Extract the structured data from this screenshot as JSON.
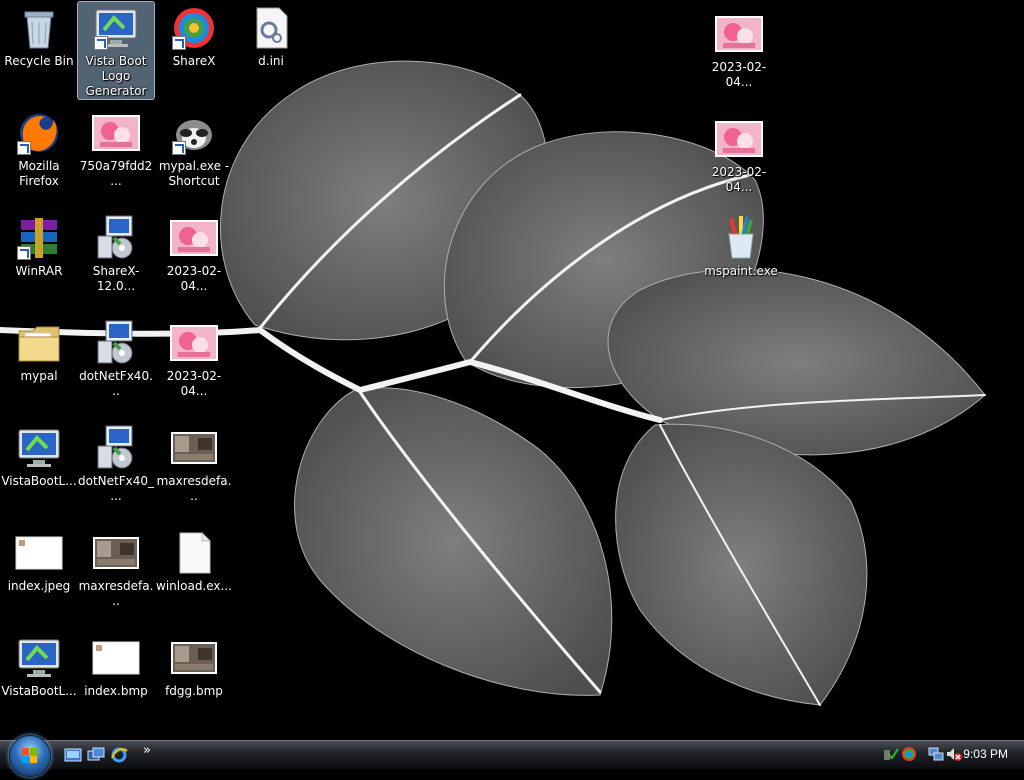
{
  "desktop": {
    "icons": [
      {
        "id": "recycle-bin",
        "label": "Recycle Bin",
        "kind": "recycle"
      },
      {
        "id": "vista-boot-logo-generator",
        "label": "Vista Boot Logo Generator",
        "kind": "vista",
        "shortcut": true,
        "selected": true
      },
      {
        "id": "sharex",
        "label": "ShareX",
        "kind": "sharex",
        "shortcut": true
      },
      {
        "id": "d-ini",
        "label": "d.ini",
        "kind": "ini"
      },
      {
        "id": "screenshot-top-right-1",
        "label": "2023-02-04...",
        "kind": "pink"
      },
      {
        "id": "screenshot-top-right-2",
        "label": "2023-02-04...",
        "kind": "pink"
      },
      {
        "id": "mozilla-firefox",
        "label": "Mozilla Firefox",
        "kind": "firefox",
        "shortcut": true
      },
      {
        "id": "image-750a79fdd2",
        "label": "750a79fdd2...",
        "kind": "pink"
      },
      {
        "id": "mypal-shortcut",
        "label": "mypal.exe - Shortcut",
        "kind": "raccoon",
        "shortcut": true
      },
      {
        "id": "mspaint",
        "label": "mspaint.exe",
        "kind": "paint"
      },
      {
        "id": "winrar",
        "label": "WinRAR",
        "kind": "winrar",
        "shortcut": true
      },
      {
        "id": "sharex-installer",
        "label": "ShareX-12.0...",
        "kind": "installer"
      },
      {
        "id": "screenshot-2023-a",
        "label": "2023-02-04...",
        "kind": "pink"
      },
      {
        "id": "mypal-folder",
        "label": "mypal",
        "kind": "folder"
      },
      {
        "id": "dotnetfx40-1",
        "label": "dotNetFx40...",
        "kind": "installer"
      },
      {
        "id": "screenshot-2023-b",
        "label": "2023-02-04...",
        "kind": "pink"
      },
      {
        "id": "vistabootl-1",
        "label": "VistaBootL...",
        "kind": "vista"
      },
      {
        "id": "dotnetfx40-2",
        "label": "dotNetFx40_...",
        "kind": "installer"
      },
      {
        "id": "maxresdefault-1",
        "label": "maxresdefa...",
        "kind": "photo"
      },
      {
        "id": "index-jpeg",
        "label": "index.jpeg",
        "kind": "whiteimg"
      },
      {
        "id": "maxresdefault-2",
        "label": "maxresdefa...",
        "kind": "photo"
      },
      {
        "id": "winload",
        "label": "winload.ex...",
        "kind": "blank"
      },
      {
        "id": "vistabootl-2",
        "label": "VistaBootL...",
        "kind": "vista"
      },
      {
        "id": "index-bmp",
        "label": "index.bmp",
        "kind": "whiteimg"
      },
      {
        "id": "fdgg-bmp",
        "label": "fdgg.bmp",
        "kind": "photo"
      }
    ]
  },
  "taskbar": {
    "start_label": "Start",
    "quick_launch": [
      "show-desktop-icon",
      "switch-windows-icon",
      "internet-explorer-icon"
    ],
    "overflow_chevron": "»",
    "tray_icons": [
      "network-icon",
      "color-wheel-icon",
      "display-icon",
      "volume-muted-icon"
    ],
    "clock": "9:03 PM"
  },
  "colors": {
    "wallpaper": "#000000",
    "taskbar": "#1d2126",
    "selection": "#96b4d2",
    "label": "#ffffff"
  }
}
